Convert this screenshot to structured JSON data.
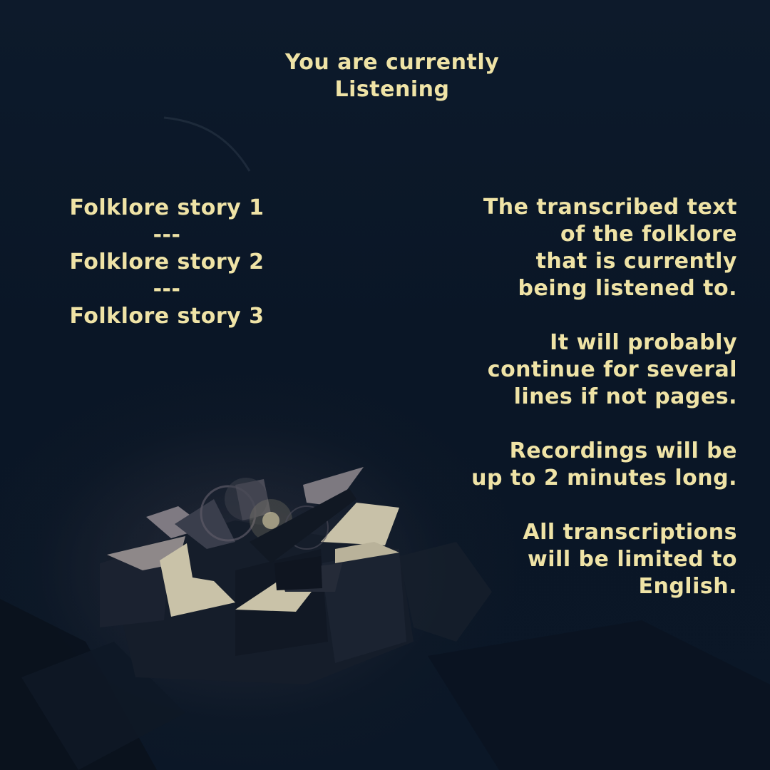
{
  "header": {
    "status_text": "You are currently\nListening"
  },
  "stories": [
    {
      "label": "Folklore story 1"
    },
    {
      "separator": "---"
    },
    {
      "label": "Folklore story 2"
    },
    {
      "separator": "---"
    },
    {
      "label": "Folklore story 3"
    }
  ],
  "transcript": {
    "paragraphs": [
      "The transcribed text\nof the folklore\nthat is currently\nbeing listened to.",
      "It will probably\ncontinue for several\nlines if not pages.",
      "Recordings will be\nup to 2 minutes long.",
      "All transcriptions\nwill be limited to\nEnglish."
    ]
  },
  "colors": {
    "background": "#0c1828",
    "text": "#efe3a6",
    "box_light": "#c9c2a8",
    "box_shadow": "#1a2232"
  }
}
